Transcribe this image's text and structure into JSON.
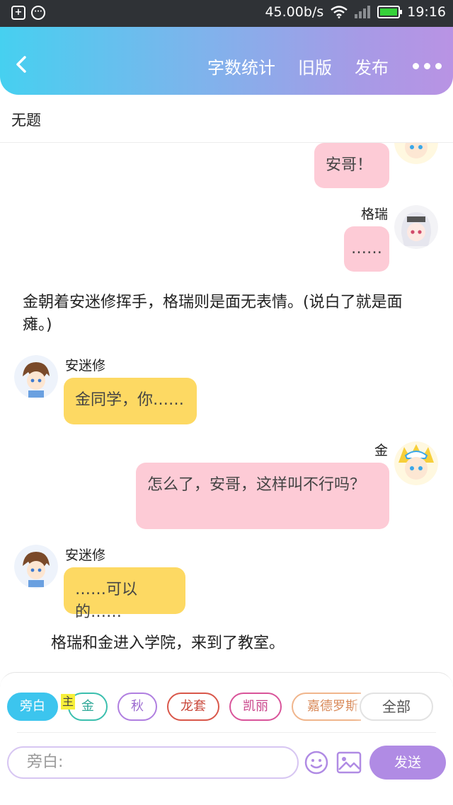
{
  "status": {
    "speed": "45.00b/s",
    "time": "19:16",
    "battery_level": 1.0
  },
  "header": {
    "actions": [
      "字数统计",
      "旧版",
      "发布"
    ],
    "gradient": [
      "#46d0f0",
      "#b993e4"
    ]
  },
  "doc_title": "无题",
  "chat": {
    "msg1": "安哥！",
    "speaker2": "格瑞",
    "msg2": "……",
    "narration1": "金朝着安迷修挥手，格瑞则是面无表情。(说白了就是面瘫。)",
    "speaker3": "安迷修",
    "msg3": "金同学，你……",
    "speaker4": "金",
    "msg4": "怎么了，安哥，这样叫不行吗？",
    "speaker5": "安迷修",
    "msg5": "……可以的……",
    "narration2": "格瑞和金进入学院，来到了教室。"
  },
  "composer": {
    "roles": [
      "旁白",
      "金",
      "秋",
      "龙套",
      "凯丽",
      "嘉德罗斯"
    ],
    "role_colors": [
      "#3cc5ee",
      "#3bbfae",
      "#b07fe0",
      "#d9574a",
      "#d9549a",
      "#f0b58c"
    ],
    "main_tag": "主",
    "all_label": "全部",
    "placeholder": "旁白:",
    "send_label": "发送",
    "accent": "#b08be4"
  }
}
